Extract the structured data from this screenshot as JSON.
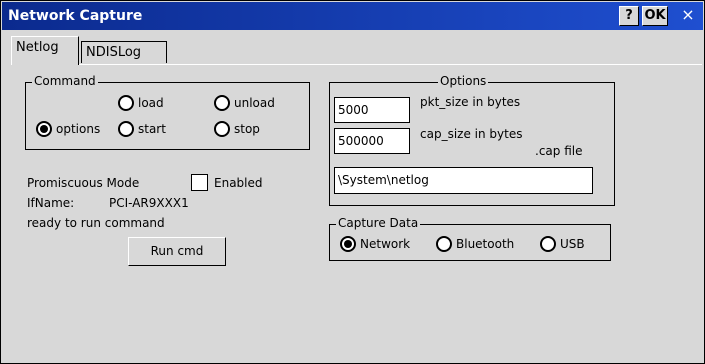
{
  "window": {
    "title": "Network Capture",
    "help_label": "?",
    "ok_label": "OK",
    "close_label": "×"
  },
  "tabs": [
    {
      "label": "Netlog",
      "active": true
    },
    {
      "label": "NDISLog",
      "active": false
    }
  ],
  "command_group": {
    "label": "Command",
    "options": [
      {
        "label": "load",
        "checked": false
      },
      {
        "label": "unload",
        "checked": false
      },
      {
        "label": "options",
        "checked": true
      },
      {
        "label": "start",
        "checked": false
      },
      {
        "label": "stop",
        "checked": false
      }
    ]
  },
  "promiscuous": {
    "label": "Promiscuous Mode",
    "checkbox_label": "Enabled",
    "checked": false
  },
  "ifname": {
    "label": "IfName:",
    "value": "PCI-AR9XXX1"
  },
  "status_text": "ready to run command",
  "run_button_label": "Run cmd",
  "options_group": {
    "label": "Options",
    "pkt_size": {
      "value": "5000",
      "label": "pkt_size in bytes"
    },
    "cap_size": {
      "value": "500000",
      "label": "cap_size in bytes"
    },
    "cap_file_label": ".cap file",
    "cap_file_path": "\\System\\netlog"
  },
  "capture_group": {
    "label": "Capture Data",
    "options": [
      {
        "label": "Network",
        "checked": true
      },
      {
        "label": "Bluetooth",
        "checked": false
      },
      {
        "label": "USB",
        "checked": false
      }
    ]
  }
}
